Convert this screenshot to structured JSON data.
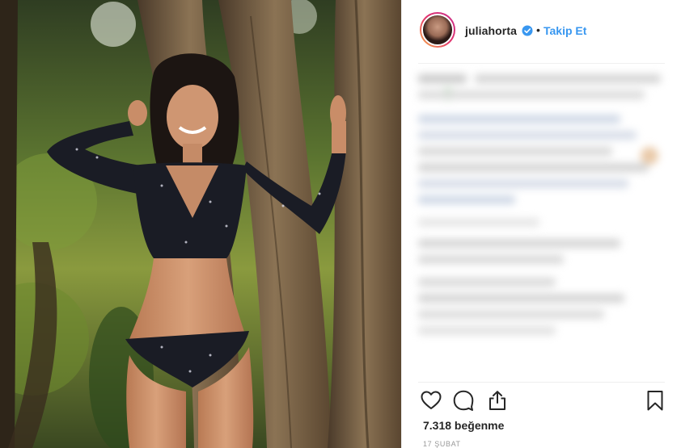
{
  "post": {
    "username": "juliahorta",
    "separator": "•",
    "follow_label": "Takip Et",
    "likes_text": "7.318 beğenme",
    "date_text": "17 ŞUBAT"
  },
  "icons": {
    "verified": "verified-badge-icon",
    "like": "heart-icon",
    "comment": "comment-bubble-icon",
    "share": "share-upload-icon",
    "save": "bookmark-icon"
  },
  "colors": {
    "link_blue": "#3897f0",
    "text_dark": "#262626",
    "muted": "#999999",
    "divider": "#efefef"
  }
}
